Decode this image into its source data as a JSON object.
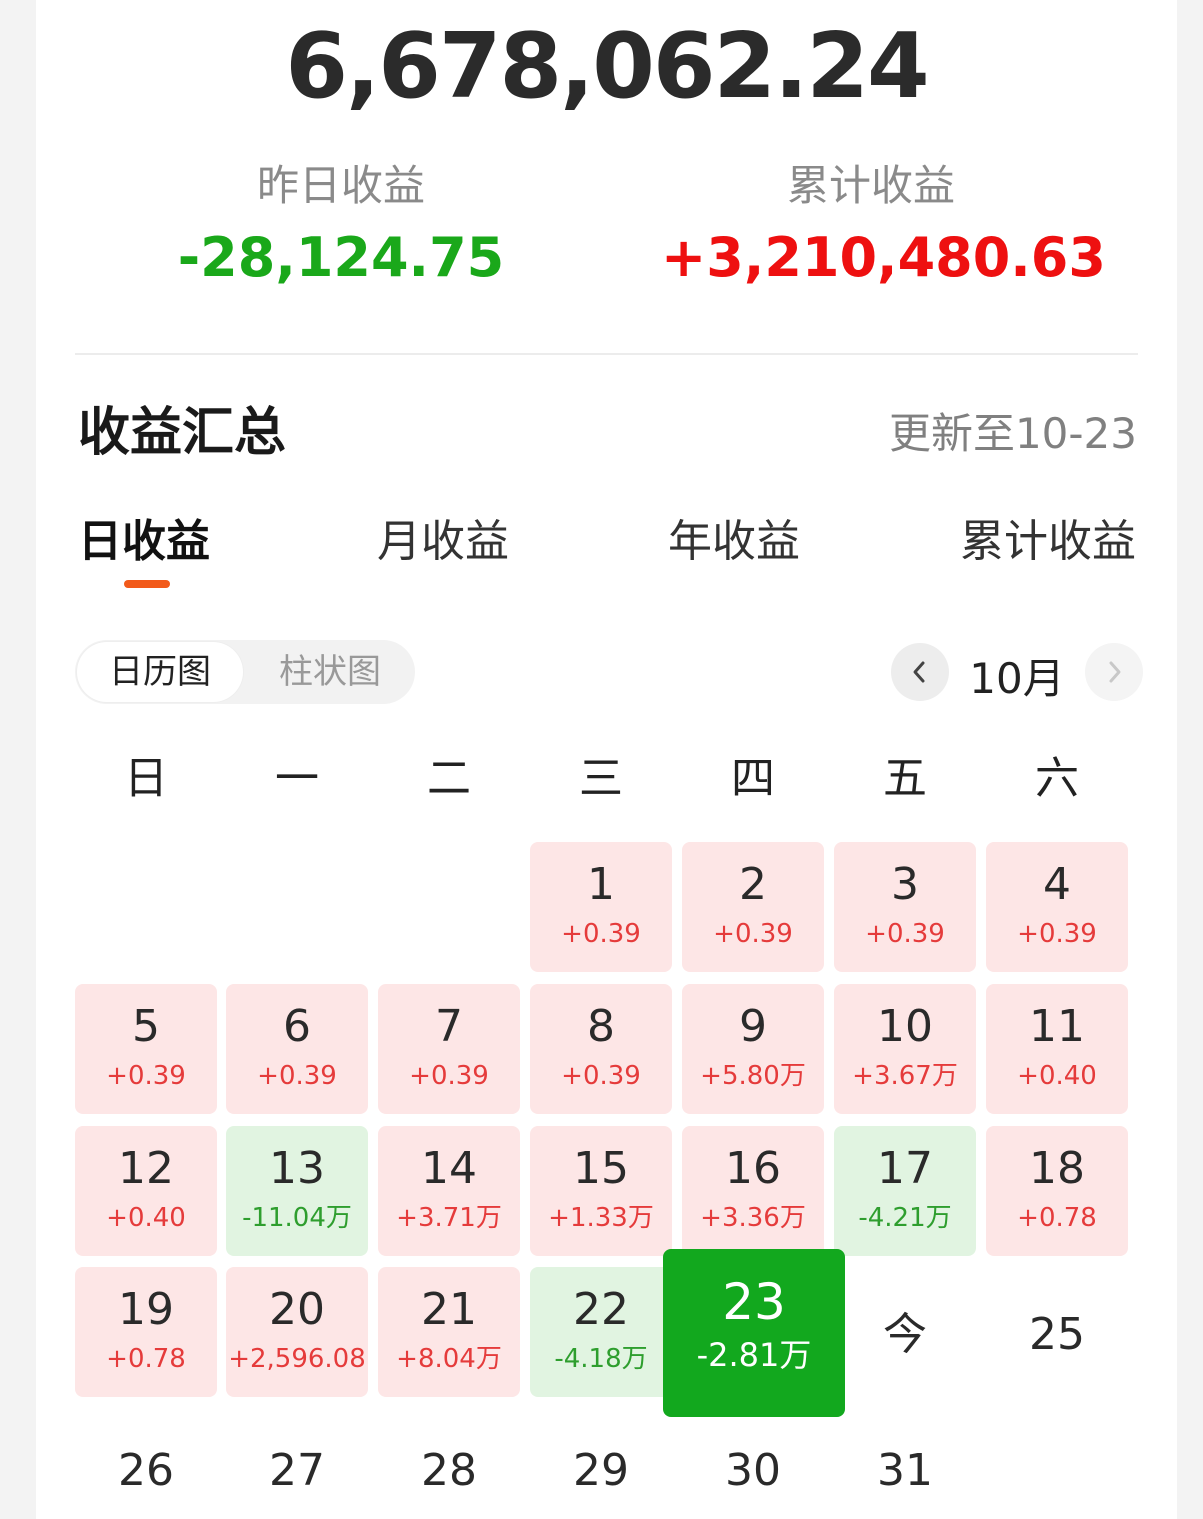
{
  "summary": {
    "total_assets": "6,678,062.24",
    "yesterday_label": "昨日收益",
    "yesterday_value": "-28,124.75",
    "cumulative_label": "累计收益",
    "cumulative_value": "+3,210,480.63"
  },
  "section": {
    "title": "收益汇总",
    "updated": "更新至10-23"
  },
  "tabs": [
    {
      "label": "日收益",
      "active": true
    },
    {
      "label": "月收益",
      "active": false
    },
    {
      "label": "年收益",
      "active": false
    },
    {
      "label": "累计收益",
      "active": false
    }
  ],
  "view_toggle": {
    "calendar": "日历图",
    "bar": "柱状图",
    "selected": "calendar"
  },
  "month_nav": {
    "month": "10月",
    "prev_icon": "chevron-left-icon",
    "next_icon": "chevron-right-icon"
  },
  "weekdays": [
    "日",
    "一",
    "二",
    "三",
    "四",
    "五",
    "六"
  ],
  "calendar": {
    "rows": [
      [
        null,
        null,
        null,
        {
          "day": "1",
          "amount": "+0.39",
          "tone": "red"
        },
        {
          "day": "2",
          "amount": "+0.39",
          "tone": "red"
        },
        {
          "day": "3",
          "amount": "+0.39",
          "tone": "red"
        },
        {
          "day": "4",
          "amount": "+0.39",
          "tone": "red"
        }
      ],
      [
        {
          "day": "5",
          "amount": "+0.39",
          "tone": "red"
        },
        {
          "day": "6",
          "amount": "+0.39",
          "tone": "red"
        },
        {
          "day": "7",
          "amount": "+0.39",
          "tone": "red"
        },
        {
          "day": "8",
          "amount": "+0.39",
          "tone": "red"
        },
        {
          "day": "9",
          "amount": "+5.80万",
          "tone": "red"
        },
        {
          "day": "10",
          "amount": "+3.67万",
          "tone": "red"
        },
        {
          "day": "11",
          "amount": "+0.40",
          "tone": "red"
        }
      ],
      [
        {
          "day": "12",
          "amount": "+0.40",
          "tone": "red"
        },
        {
          "day": "13",
          "amount": "-11.04万",
          "tone": "green"
        },
        {
          "day": "14",
          "amount": "+3.71万",
          "tone": "red"
        },
        {
          "day": "15",
          "amount": "+1.33万",
          "tone": "red"
        },
        {
          "day": "16",
          "amount": "+3.36万",
          "tone": "red"
        },
        {
          "day": "17",
          "amount": "-4.21万",
          "tone": "green"
        },
        {
          "day": "18",
          "amount": "+0.78",
          "tone": "red"
        }
      ],
      [
        {
          "day": "19",
          "amount": "+0.78",
          "tone": "red"
        },
        {
          "day": "20",
          "amount": "+2,596.08",
          "tone": "red"
        },
        {
          "day": "21",
          "amount": "+8.04万",
          "tone": "red"
        },
        {
          "day": "22",
          "amount": "-4.18万",
          "tone": "green"
        },
        {
          "day": "23",
          "amount": "-2.81万",
          "tone": "selected"
        },
        {
          "day": "今",
          "amount": "",
          "tone": "plain"
        },
        {
          "day": "25",
          "amount": "",
          "tone": "plain"
        }
      ],
      [
        {
          "day": "26",
          "amount": "",
          "tone": "plain"
        },
        {
          "day": "27",
          "amount": "",
          "tone": "plain"
        },
        {
          "day": "28",
          "amount": "",
          "tone": "plain"
        },
        {
          "day": "29",
          "amount": "",
          "tone": "plain"
        },
        {
          "day": "30",
          "amount": "",
          "tone": "plain"
        },
        {
          "day": "31",
          "amount": "",
          "tone": "plain"
        },
        null
      ]
    ]
  },
  "colors": {
    "accent": "#f25a1a",
    "gain": "#ee1010",
    "loss": "#1aa81a",
    "selected": "#12a81e"
  }
}
